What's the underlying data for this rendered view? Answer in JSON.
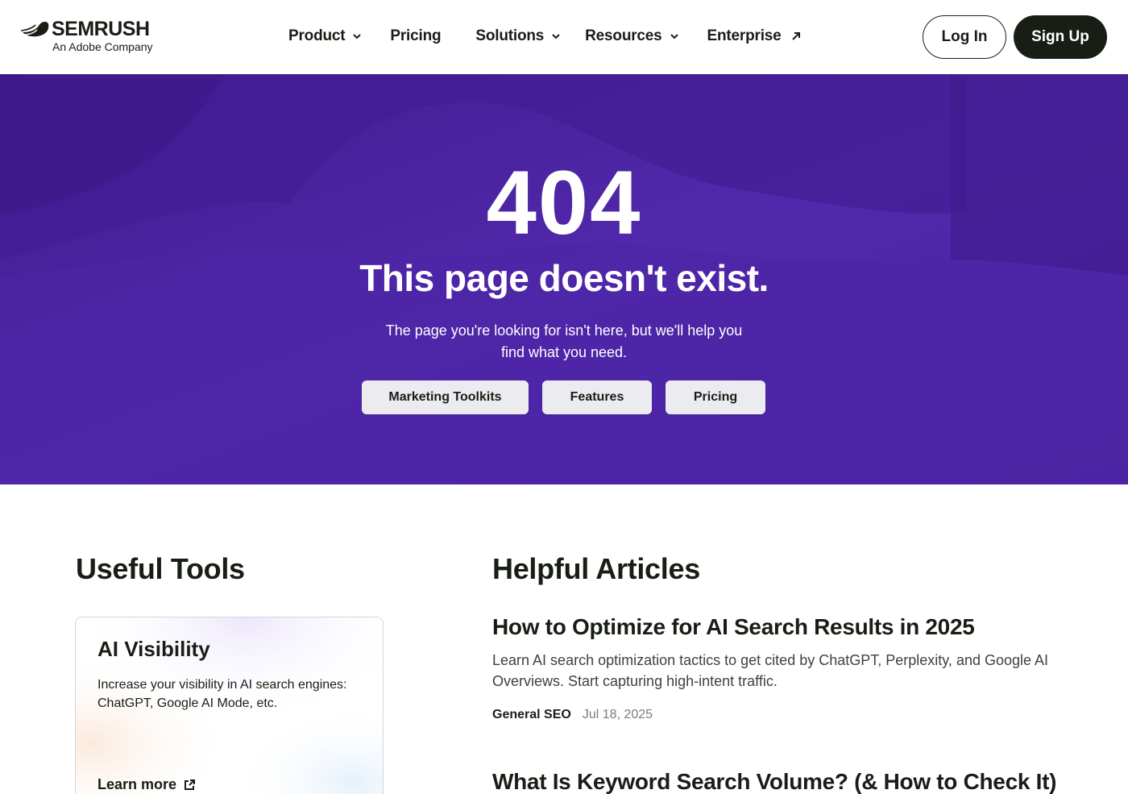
{
  "brand": {
    "name": "SEMRUSH",
    "tagline": "An Adobe Company"
  },
  "nav": {
    "items": [
      {
        "label": "Product",
        "has_dropdown": true
      },
      {
        "label": "Pricing",
        "has_dropdown": false
      },
      {
        "label": "Solutions",
        "has_dropdown": true
      },
      {
        "label": "Resources",
        "has_dropdown": true
      },
      {
        "label": "Enterprise",
        "external": true
      }
    ],
    "login_label": "Log In",
    "signup_label": "Sign Up"
  },
  "hero": {
    "code": "404",
    "title": "This page doesn't exist.",
    "description": "The page you're looking for isn't here, but we'll help you find what you need.",
    "buttons": [
      "Marketing Toolkits",
      "Features",
      "Pricing"
    ]
  },
  "tools": {
    "heading": "Useful Tools",
    "cards": [
      {
        "title": "AI Visibility",
        "description": "Increase your visibility in AI search engines: ChatGPT, Google AI Mode, etc.",
        "link_label": "Learn more"
      }
    ]
  },
  "articles": {
    "heading": "Helpful Articles",
    "items": [
      {
        "title": "How to Optimize for AI Search Results in 2025",
        "description": "Learn AI search optimization tactics to get cited by ChatGPT, Perplexity, and Google AI Overviews. Start capturing high-intent traffic.",
        "category": "General SEO",
        "date": "Jul 18, 2025"
      },
      {
        "title": "What Is Keyword Search Volume? (& How to Check It)"
      }
    ]
  },
  "colors": {
    "hero_purple": "#4f24a8",
    "dark": "#181e15",
    "button_light": "#ebebf0"
  },
  "icons": [
    "semrush-logo-icon",
    "chevron-down-icon",
    "external-arrow-icon",
    "external-link-icon"
  ]
}
